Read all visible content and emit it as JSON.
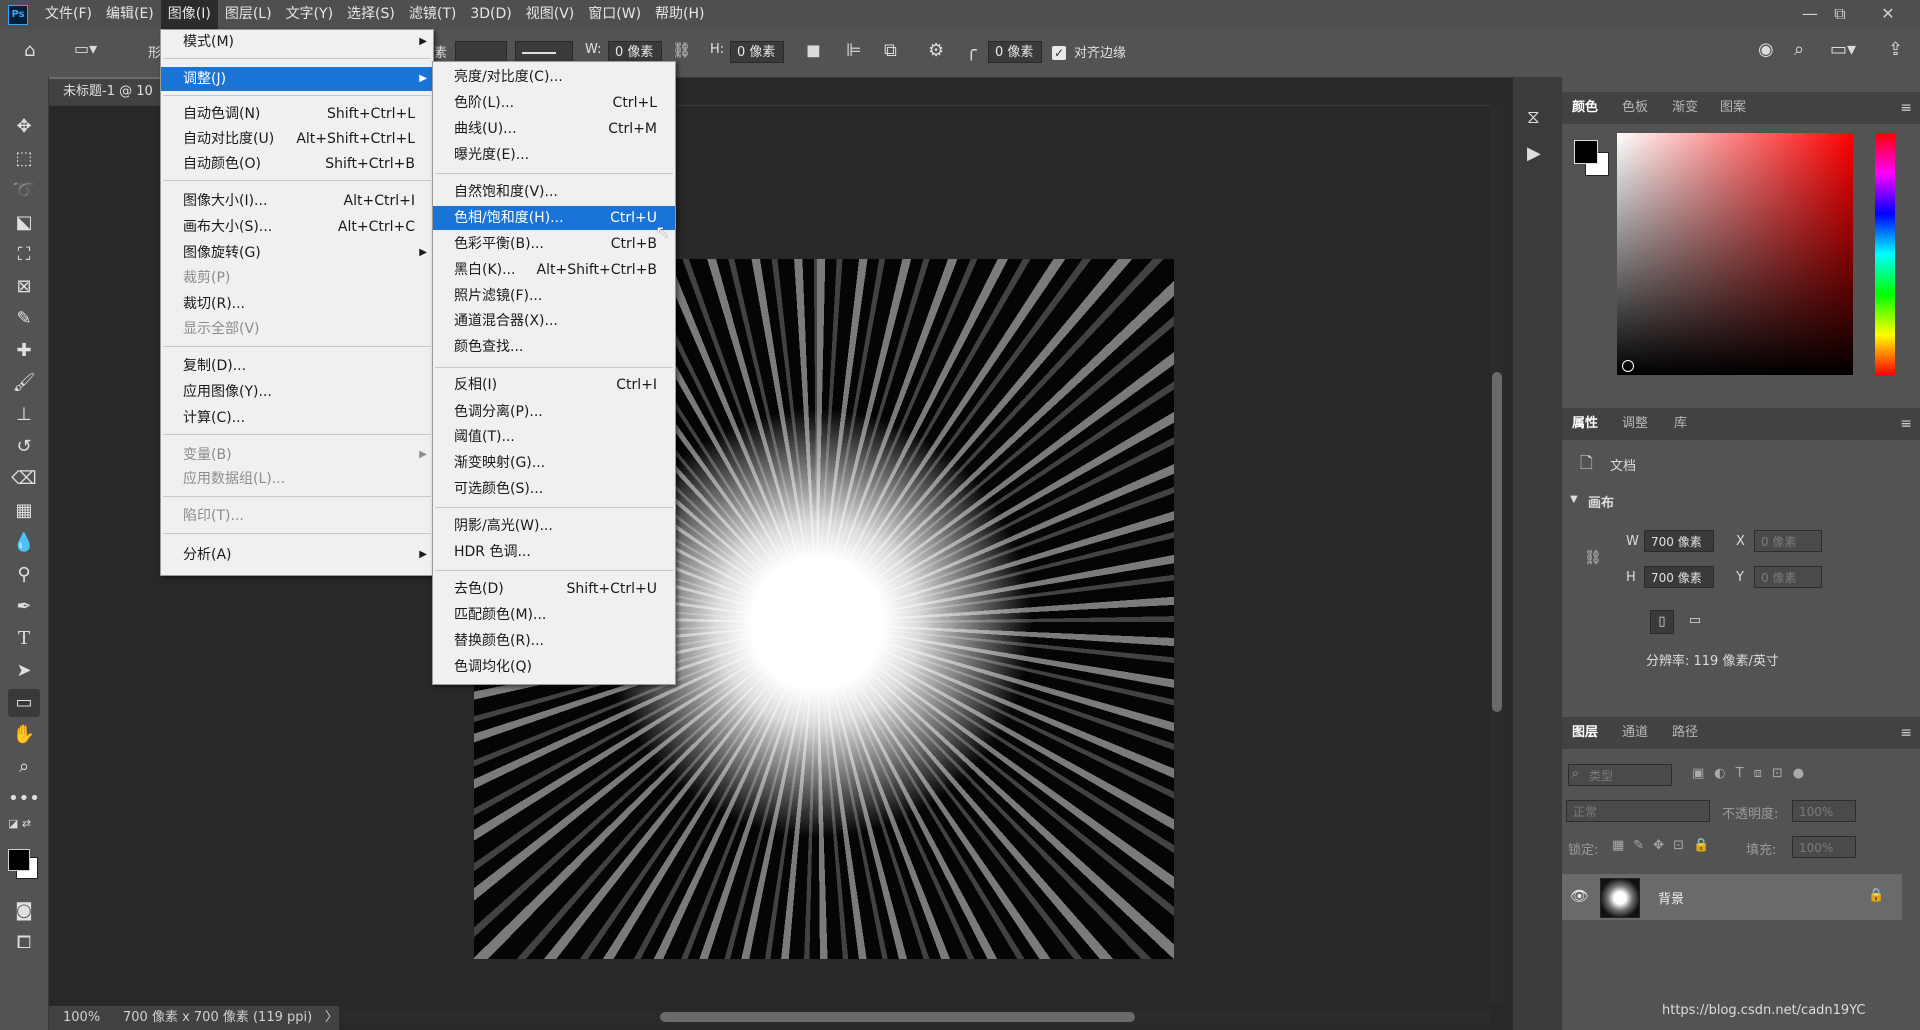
{
  "app": {
    "logo": "Ps"
  },
  "menubar": {
    "items": [
      "文件(F)",
      "编辑(E)",
      "图像(I)",
      "图层(L)",
      "文字(Y)",
      "选择(S)",
      "滤镜(T)",
      "3D(D)",
      "视图(V)",
      "窗口(W)",
      "帮助(H)"
    ],
    "active_index": 2
  },
  "window_controls": {
    "minimize": "—",
    "restore": "⧉",
    "close": "✕"
  },
  "options_bar": {
    "w_label": "W:",
    "w_value": "0 像素",
    "h_label": "H:",
    "h_value": "0 像素",
    "corner_value": "0 像素",
    "align_edges_label": "对齐边缘",
    "align_edges_checked": true,
    "partial_text": "形",
    "partial_text2": "素"
  },
  "document": {
    "tab_title": "未标题-1 @ 10",
    "zoom": "100%",
    "info": "700 像素 x 700 像素 (119 ppi)",
    "info_arrow": "〉"
  },
  "image_menu": {
    "items": [
      {
        "label": "模式(M)",
        "shortcut": "",
        "submenu": true,
        "disabled": false
      },
      {
        "label": "调整(J)",
        "shortcut": "",
        "submenu": true,
        "disabled": false,
        "highlighted": true
      },
      {
        "label": "自动色调(N)",
        "shortcut": "Shift+Ctrl+L"
      },
      {
        "label": "自动对比度(U)",
        "shortcut": "Alt+Shift+Ctrl+L"
      },
      {
        "label": "自动颜色(O)",
        "shortcut": "Shift+Ctrl+B"
      },
      {
        "label": "图像大小(I)...",
        "shortcut": "Alt+Ctrl+I"
      },
      {
        "label": "画布大小(S)...",
        "shortcut": "Alt+Ctrl+C"
      },
      {
        "label": "图像旋转(G)",
        "shortcut": "",
        "submenu": true
      },
      {
        "label": "裁剪(P)",
        "shortcut": "",
        "disabled": true
      },
      {
        "label": "裁切(R)...",
        "shortcut": ""
      },
      {
        "label": "显示全部(V)",
        "shortcut": "",
        "disabled": true
      },
      {
        "label": "复制(D)...",
        "shortcut": ""
      },
      {
        "label": "应用图像(Y)...",
        "shortcut": ""
      },
      {
        "label": "计算(C)...",
        "shortcut": ""
      },
      {
        "label": "变量(B)",
        "shortcut": "",
        "submenu": true,
        "disabled": true
      },
      {
        "label": "应用数据组(L)...",
        "shortcut": "",
        "disabled": true
      },
      {
        "label": "陷印(T)...",
        "shortcut": "",
        "disabled": true
      },
      {
        "label": "分析(A)",
        "shortcut": "",
        "submenu": true
      }
    ]
  },
  "adjust_menu": {
    "items": [
      {
        "label": "亮度/对比度(C)...",
        "shortcut": ""
      },
      {
        "label": "色阶(L)...",
        "shortcut": "Ctrl+L"
      },
      {
        "label": "曲线(U)...",
        "shortcut": "Ctrl+M"
      },
      {
        "label": "曝光度(E)...",
        "shortcut": ""
      },
      {
        "label": "自然饱和度(V)...",
        "shortcut": ""
      },
      {
        "label": "色相/饱和度(H)...",
        "shortcut": "Ctrl+U",
        "highlighted": true
      },
      {
        "label": "色彩平衡(B)...",
        "shortcut": "Ctrl+B"
      },
      {
        "label": "黑白(K)...",
        "shortcut": "Alt+Shift+Ctrl+B"
      },
      {
        "label": "照片滤镜(F)...",
        "shortcut": ""
      },
      {
        "label": "通道混合器(X)...",
        "shortcut": ""
      },
      {
        "label": "颜色查找...",
        "shortcut": ""
      },
      {
        "label": "反相(I)",
        "shortcut": "Ctrl+I"
      },
      {
        "label": "色调分离(P)...",
        "shortcut": ""
      },
      {
        "label": "阈值(T)...",
        "shortcut": ""
      },
      {
        "label": "渐变映射(G)...",
        "shortcut": ""
      },
      {
        "label": "可选颜色(S)...",
        "shortcut": ""
      },
      {
        "label": "阴影/高光(W)...",
        "shortcut": ""
      },
      {
        "label": "HDR 色调...",
        "shortcut": ""
      },
      {
        "label": "去色(D)",
        "shortcut": "Shift+Ctrl+U"
      },
      {
        "label": "匹配颜色(M)...",
        "shortcut": ""
      },
      {
        "label": "替换颜色(R)...",
        "shortcut": ""
      },
      {
        "label": "色调均化(Q)",
        "shortcut": ""
      }
    ]
  },
  "color_panel": {
    "tabs": [
      "颜色",
      "色板",
      "渐变",
      "图案"
    ],
    "hue_color": "#ff0000",
    "foreground": "#000000",
    "background": "#ffffff"
  },
  "properties_panel": {
    "tabs": [
      "属性",
      "调整",
      "库"
    ],
    "doc_label": "文档",
    "canvas_section": "画布",
    "w_label": "W",
    "w_value": "700 像素",
    "h_label": "H",
    "h_value": "700 像素",
    "x_label": "X",
    "x_placeholder": "0 像素",
    "y_label": "Y",
    "y_placeholder": "0 像素",
    "resolution": "分辨率: 119 像素/英寸"
  },
  "layers_panel": {
    "tabs": [
      "图层",
      "通道",
      "路径"
    ],
    "filter_placeholder": "类型",
    "blend_mode": "正常",
    "opacity_label": "不透明度:",
    "opacity_value": "100%",
    "lock_label": "锁定:",
    "fill_label": "填充:",
    "fill_value": "100%",
    "layers": [
      {
        "name": "背景",
        "visible": true,
        "locked": true
      }
    ]
  },
  "watermark": "https://blog.csdn.net/cadn19YC"
}
